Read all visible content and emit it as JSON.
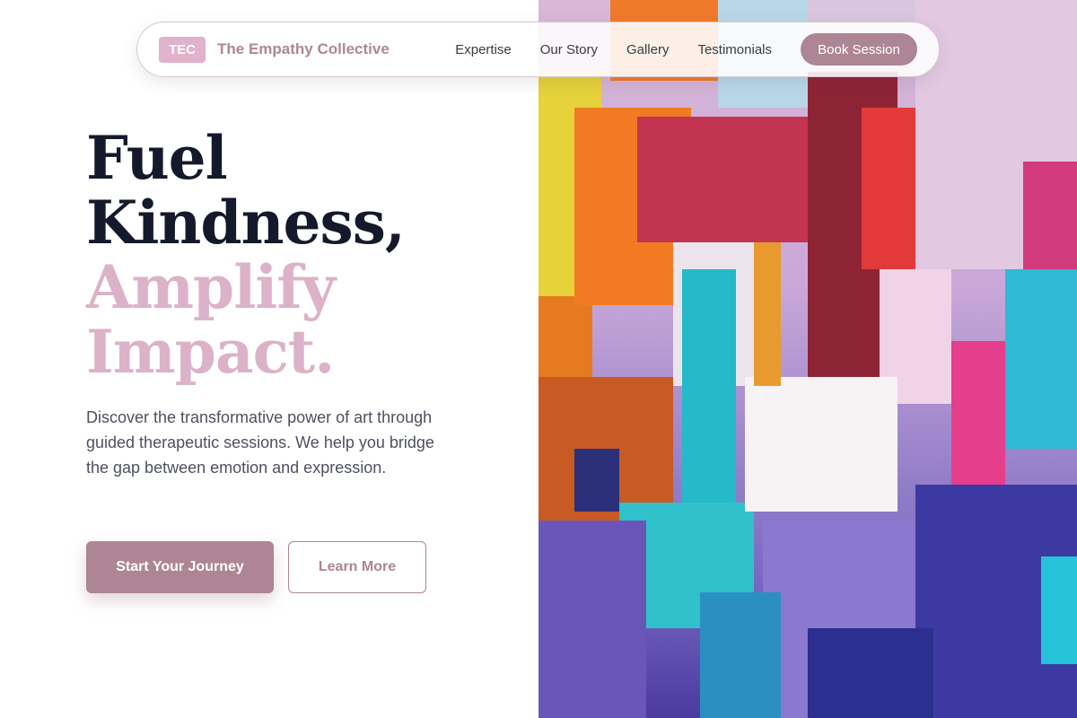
{
  "nav": {
    "logo_text": "TEC",
    "brand_name": "The Empathy Collective",
    "links": [
      "Expertise",
      "Our Story",
      "Gallery",
      "Testimonials"
    ],
    "cta": "Book Session"
  },
  "hero": {
    "title_line1": "Fuel",
    "title_line2": "Kindness,",
    "title_line3": "Amplify",
    "title_line4": "Impact.",
    "description": "Discover the transformative power of art through guided therapeutic sessions. We help you bridge the gap between emotion and expression.",
    "primary_button": "Start Your Journey",
    "secondary_button": "Learn More"
  },
  "colors": {
    "accent": "#ae8594",
    "accent_light": "#dcb2c9",
    "title_dark": "#141a2b"
  },
  "artwork": {
    "description": "abstract-paint-texture"
  }
}
